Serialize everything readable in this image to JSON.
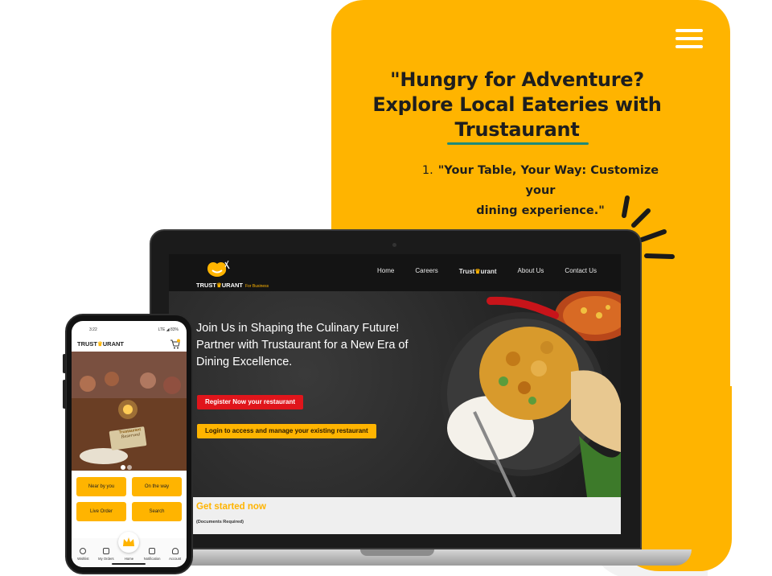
{
  "promo": {
    "headline_line1": "\"Hungry for Adventure?",
    "headline_line2": "Explore Local Eateries with",
    "headline_brand": "Trustaurant",
    "tagline_number": "1.",
    "tagline_line1": "\"Your Table, Your Way: Customize your",
    "tagline_line2": "dining experience.\"",
    "colors": {
      "accent": "#FFB400",
      "underline": "#1e8a7a"
    }
  },
  "site": {
    "logo_text_1": "TRUST",
    "logo_text_2": "URANT",
    "logo_business": "For Business",
    "nav": {
      "home": "Home",
      "careers": "Careers",
      "brand_1": "Trust",
      "brand_2": "urant",
      "about": "About Us",
      "contact": "Contact Us"
    },
    "hero_line1": "Join Us in Shaping the Culinary Future!",
    "hero_line2": "Partner with Trustaurant for a New Era of",
    "hero_line3": "Dining Excellence.",
    "register_button": "Register Now your restaurant",
    "login_button": "Login to access and manage your existing restaurant",
    "get_started_title": "Get started now",
    "get_started_sub": "(Documents Required)",
    "colors": {
      "register": "#e0151b",
      "login": "#FFB400"
    }
  },
  "phone": {
    "time": "3:22",
    "status_right": "LTE ◢ 83%",
    "logo_1": "TRUST",
    "logo_2": "URANT",
    "sign_line1": "Trustaurant",
    "sign_line2": "Reserved",
    "buttons": [
      "Near by you",
      "On the way",
      "Live Order",
      "Search"
    ],
    "tabs": [
      "Wishlist",
      "My Orders",
      "Home",
      "Notification",
      "Account"
    ]
  }
}
